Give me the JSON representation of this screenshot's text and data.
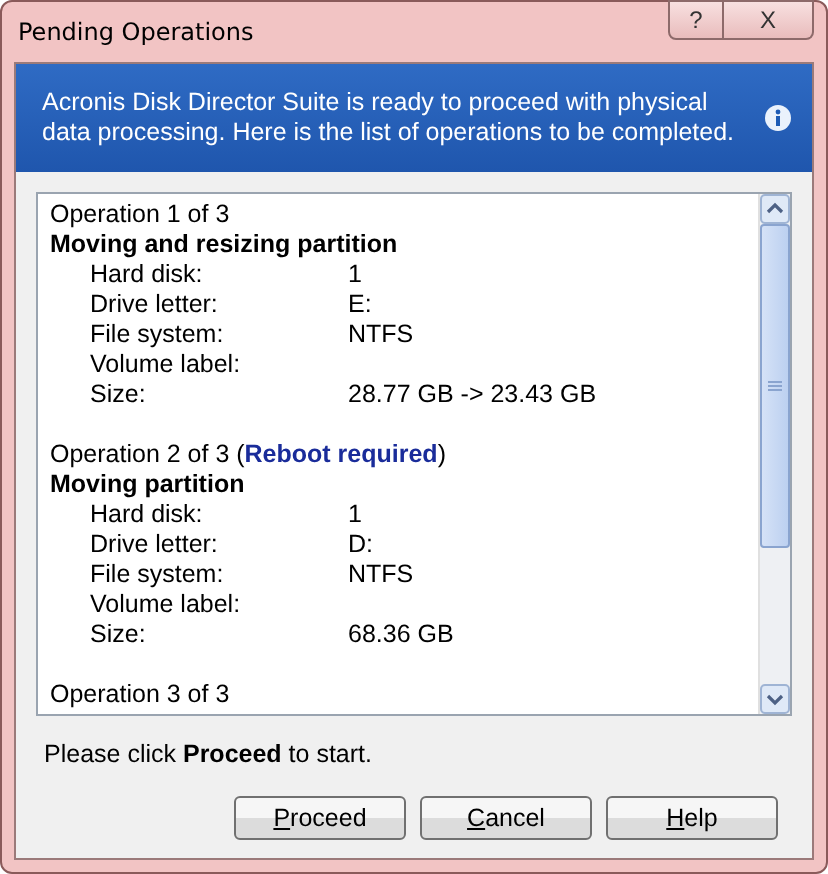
{
  "window": {
    "title": "Pending Operations",
    "controls": [
      "?",
      "X"
    ]
  },
  "header": {
    "message": "Acronis Disk Director Suite is ready to proceed with physical data processing. Here is the list of operations to be completed."
  },
  "operations": [
    {
      "title": "Operation 1 of 3",
      "action": "Moving and resizing partition",
      "fields": [
        {
          "label": "Hard disk:",
          "value": "1"
        },
        {
          "label": "Drive letter:",
          "value": "E:"
        },
        {
          "label": "File system:",
          "value": "NTFS"
        },
        {
          "label": "Volume label:"
        },
        {
          "label": "Size:",
          "value": "28.77 GB -> 23.43 GB"
        }
      ]
    },
    {
      "title": "Operation 2 of 3 (**Reboot required**)",
      "action": "Moving partition",
      "fields": [
        {
          "label": "Hard disk:",
          "value": "1"
        },
        {
          "label": "Drive letter:",
          "value": "D:"
        },
        {
          "label": "File system:",
          "value": "NTFS"
        },
        {
          "label": "Volume label:"
        },
        {
          "label": "Size:",
          "value": "68.36 GB"
        }
      ]
    },
    {
      "title": "Operation 3 of 3"
    }
  ],
  "footer": {
    "instruction": "Please click **Proceed** to start."
  },
  "buttons": [
    {
      "accel": "P",
      "rest": "roceed"
    },
    {
      "accel": "C",
      "rest": "ancel"
    },
    {
      "accel": "H",
      "rest": "elp"
    }
  ]
}
